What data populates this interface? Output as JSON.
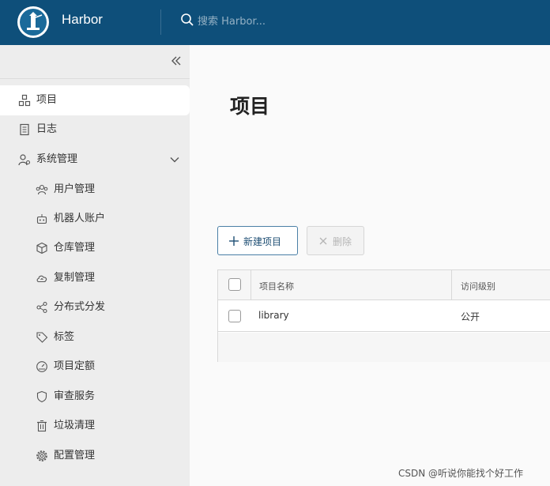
{
  "header": {
    "app_title": "Harbor",
    "search_placeholder": "搜索 Harbor..."
  },
  "sidebar": {
    "items": [
      {
        "label": "项目",
        "icon": "projects-icon",
        "active": true
      },
      {
        "label": "日志",
        "icon": "logs-icon"
      },
      {
        "label": "系统管理",
        "icon": "admin-icon",
        "expanded": true
      },
      {
        "label": "用户管理",
        "icon": "users-icon"
      },
      {
        "label": "机器人账户",
        "icon": "robot-icon"
      },
      {
        "label": "仓库管理",
        "icon": "registry-icon"
      },
      {
        "label": "复制管理",
        "icon": "cloud-icon"
      },
      {
        "label": "分布式分发",
        "icon": "share-icon"
      },
      {
        "label": "标签",
        "icon": "tag-icon"
      },
      {
        "label": "项目定额",
        "icon": "quota-icon"
      },
      {
        "label": "审查服务",
        "icon": "shield-icon"
      },
      {
        "label": "垃圾清理",
        "icon": "trash-icon"
      },
      {
        "label": "配置管理",
        "icon": "gear-icon"
      }
    ]
  },
  "main": {
    "page_title": "项目",
    "new_project_label": "新建项目",
    "delete_label": "删除",
    "table": {
      "columns": [
        "项目名称",
        "访问级别"
      ],
      "rows": [
        {
          "name": "library",
          "access": "公开"
        }
      ]
    }
  },
  "watermark": "CSDN @听说你能找个好工作",
  "colors": {
    "header_bg": "#0e4f7a",
    "accent": "#2f78b3",
    "sidebar_bg": "#ededed"
  }
}
